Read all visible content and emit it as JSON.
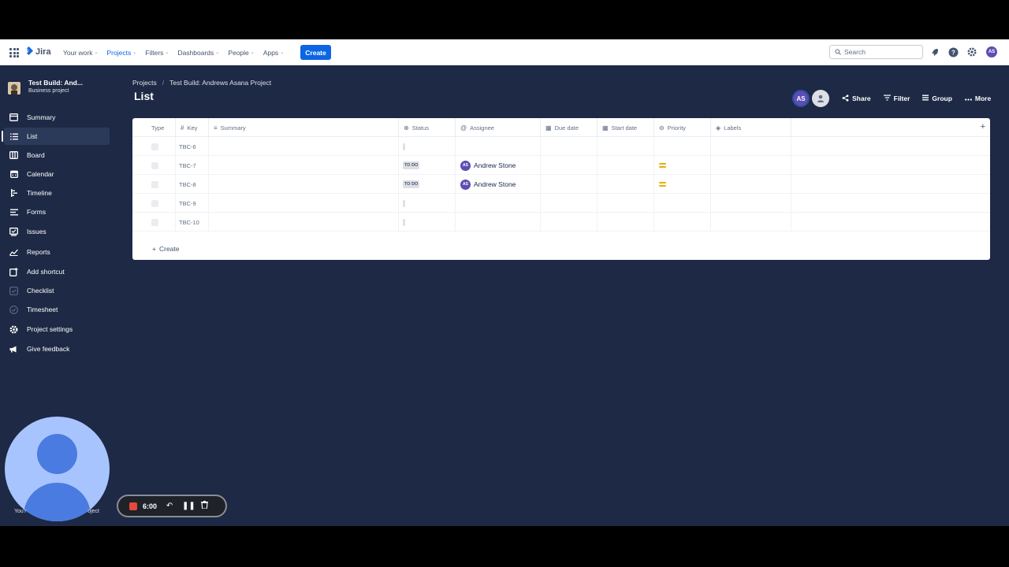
{
  "nav": {
    "logo": "Jira",
    "items": [
      {
        "label": "Your work",
        "active": false
      },
      {
        "label": "Projects",
        "active": true
      },
      {
        "label": "Filters",
        "active": false
      },
      {
        "label": "Dashboards",
        "active": false
      },
      {
        "label": "People",
        "active": false
      },
      {
        "label": "Apps",
        "active": false
      }
    ],
    "create_label": "Create",
    "search_placeholder": "Search",
    "avatar_initials": "AS"
  },
  "sidebar": {
    "project_name": "Test Build: And...",
    "project_type": "Business project",
    "items": [
      {
        "label": "Summary",
        "icon": "summary-icon"
      },
      {
        "label": "List",
        "icon": "list-icon",
        "active": true
      },
      {
        "label": "Board",
        "icon": "board-icon"
      },
      {
        "label": "Calendar",
        "icon": "calendar-icon"
      },
      {
        "label": "Timeline",
        "icon": "timeline-icon"
      },
      {
        "label": "Forms",
        "icon": "forms-icon"
      },
      {
        "label": "Issues",
        "icon": "issues-icon"
      },
      {
        "label": "Reports",
        "icon": "reports-icon"
      },
      {
        "label": "Add shortcut",
        "icon": "add-shortcut-icon"
      },
      {
        "label": "Checklist",
        "icon": "checklist-icon"
      },
      {
        "label": "Timesheet",
        "icon": "timesheet-icon"
      },
      {
        "label": "Project settings",
        "icon": "gear-icon"
      },
      {
        "label": "Give feedback",
        "icon": "megaphone-icon"
      }
    ]
  },
  "breadcrumb": {
    "root": "Projects",
    "separator": "/",
    "project": "Test Build: Andrews Asana Project"
  },
  "page_title": "List",
  "toolbar": {
    "avatar_initials": "AS",
    "share": "Share",
    "filter": "Filter",
    "group": "Group",
    "more": "More"
  },
  "table": {
    "columns": [
      "Type",
      "Key",
      "Summary",
      "Status",
      "Assignee",
      "Due date",
      "Start date",
      "Priority",
      "Labels"
    ],
    "rows": [
      {
        "key": "TBC-6",
        "status": "",
        "assignee": "",
        "assignee_initials": "",
        "priority": ""
      },
      {
        "key": "TBC-7",
        "status": "TO DO",
        "assignee": "Andrew Stone",
        "assignee_initials": "AS",
        "priority": "medium"
      },
      {
        "key": "TBC-8",
        "status": "TO DO",
        "assignee": "Andrew Stone",
        "assignee_initials": "AS",
        "priority": "medium"
      },
      {
        "key": "TBC-9",
        "status": "",
        "assignee": "",
        "assignee_initials": "",
        "priority": ""
      },
      {
        "key": "TBC-10",
        "status": "",
        "assignee": "",
        "assignee_initials": "",
        "priority": ""
      }
    ],
    "create_label": "Create"
  },
  "recorder": {
    "time": "6:00",
    "caption_left": "You'r",
    "caption_right": "oject"
  },
  "colors": {
    "background": "#1d2945",
    "primary": "#0c66e4",
    "avatar": "#5e4db2",
    "priority_medium": "#e2b203",
    "record": "#e5483d"
  }
}
